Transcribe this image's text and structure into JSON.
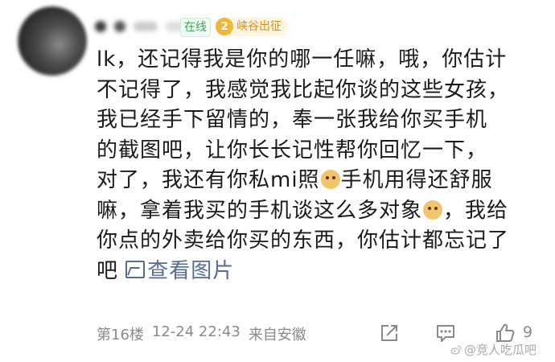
{
  "badges": {
    "online": "在线",
    "level": "2",
    "certification": "峡谷出征"
  },
  "comment": {
    "lines": [
      "lk，还记得我是你的哪一任嘛，哦，你估计",
      "不记得了，我感觉我比起你谈的这些女孩，",
      "我已经手下留情的，奉一张我给你买手机",
      "的截图吧，让你长长记性帮你回忆一下，"
    ],
    "line5_a": "对了，我还有你私mi照",
    "line5_b": "手机用得还舒服",
    "line6_a": "嘛，拿着我买的手机谈这么多对象",
    "line6_b": "，我给",
    "line7": "你点的外卖给你买的东西，你估计都忘记了",
    "line8": "吧",
    "view_image": "查看图片"
  },
  "meta": {
    "floor": "第16楼",
    "datetime": "12-24 22:43",
    "location": "来自安徽"
  },
  "actions": {
    "like_count": "9"
  },
  "watermark": "@竞人吃瓜吧",
  "colors": {
    "link": "#576b95",
    "meta": "#8a8a8a",
    "online": "#3aa55a",
    "badge": "#f0b63a"
  },
  "icons": [
    "share-icon",
    "comment-icon",
    "like-icon",
    "picture-icon",
    "doge-emoji"
  ]
}
